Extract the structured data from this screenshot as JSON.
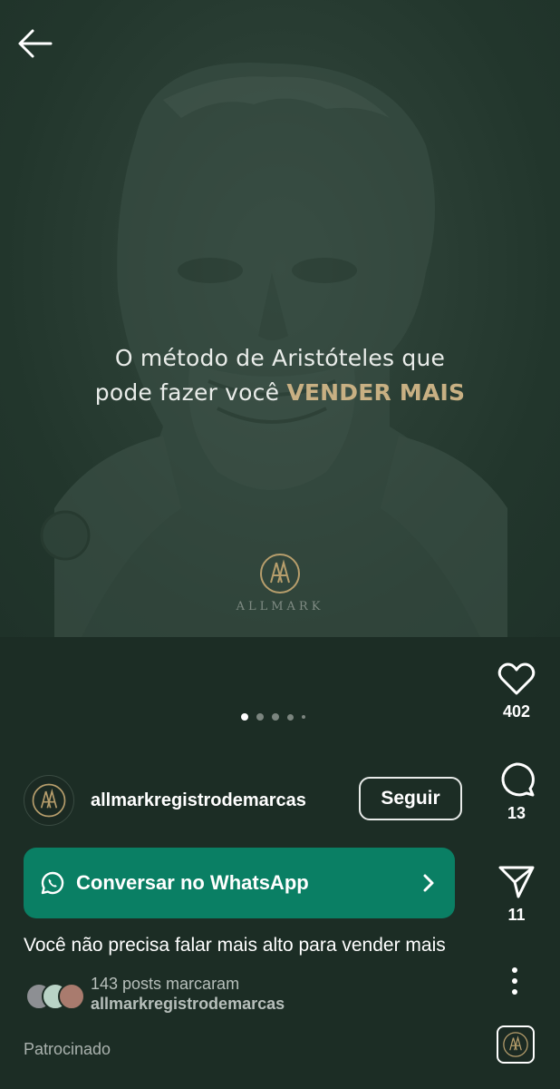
{
  "post": {
    "headline_line1": "O método de Aristóteles que",
    "headline_line2_prefix": "pode fazer você ",
    "headline_accent": "VENDER MAIS",
    "brand_word": "ALLMARK",
    "carousel": {
      "total": 5,
      "active": 0
    }
  },
  "actions": {
    "likes": "402",
    "comments": "13",
    "shares": "11"
  },
  "author": {
    "username": "allmarkregistrodemarcas",
    "follow_label": "Seguir"
  },
  "cta": {
    "label": "Conversar no WhatsApp"
  },
  "caption": "Você não precisa falar mais alto para vender mais",
  "tagged": {
    "count_text": "143 posts marcaram",
    "account": "allmarkregistrodemarcas"
  },
  "sponsored_label": "Patrocinado",
  "colors": {
    "background": "#1c2d25",
    "accent_gold": "#c8b083",
    "cta_green": "#0a7f64"
  },
  "icons": [
    "back-arrow-icon",
    "heart-icon",
    "comment-icon",
    "share-icon",
    "more-vertical-icon",
    "whatsapp-icon",
    "chevron-right-icon"
  ]
}
